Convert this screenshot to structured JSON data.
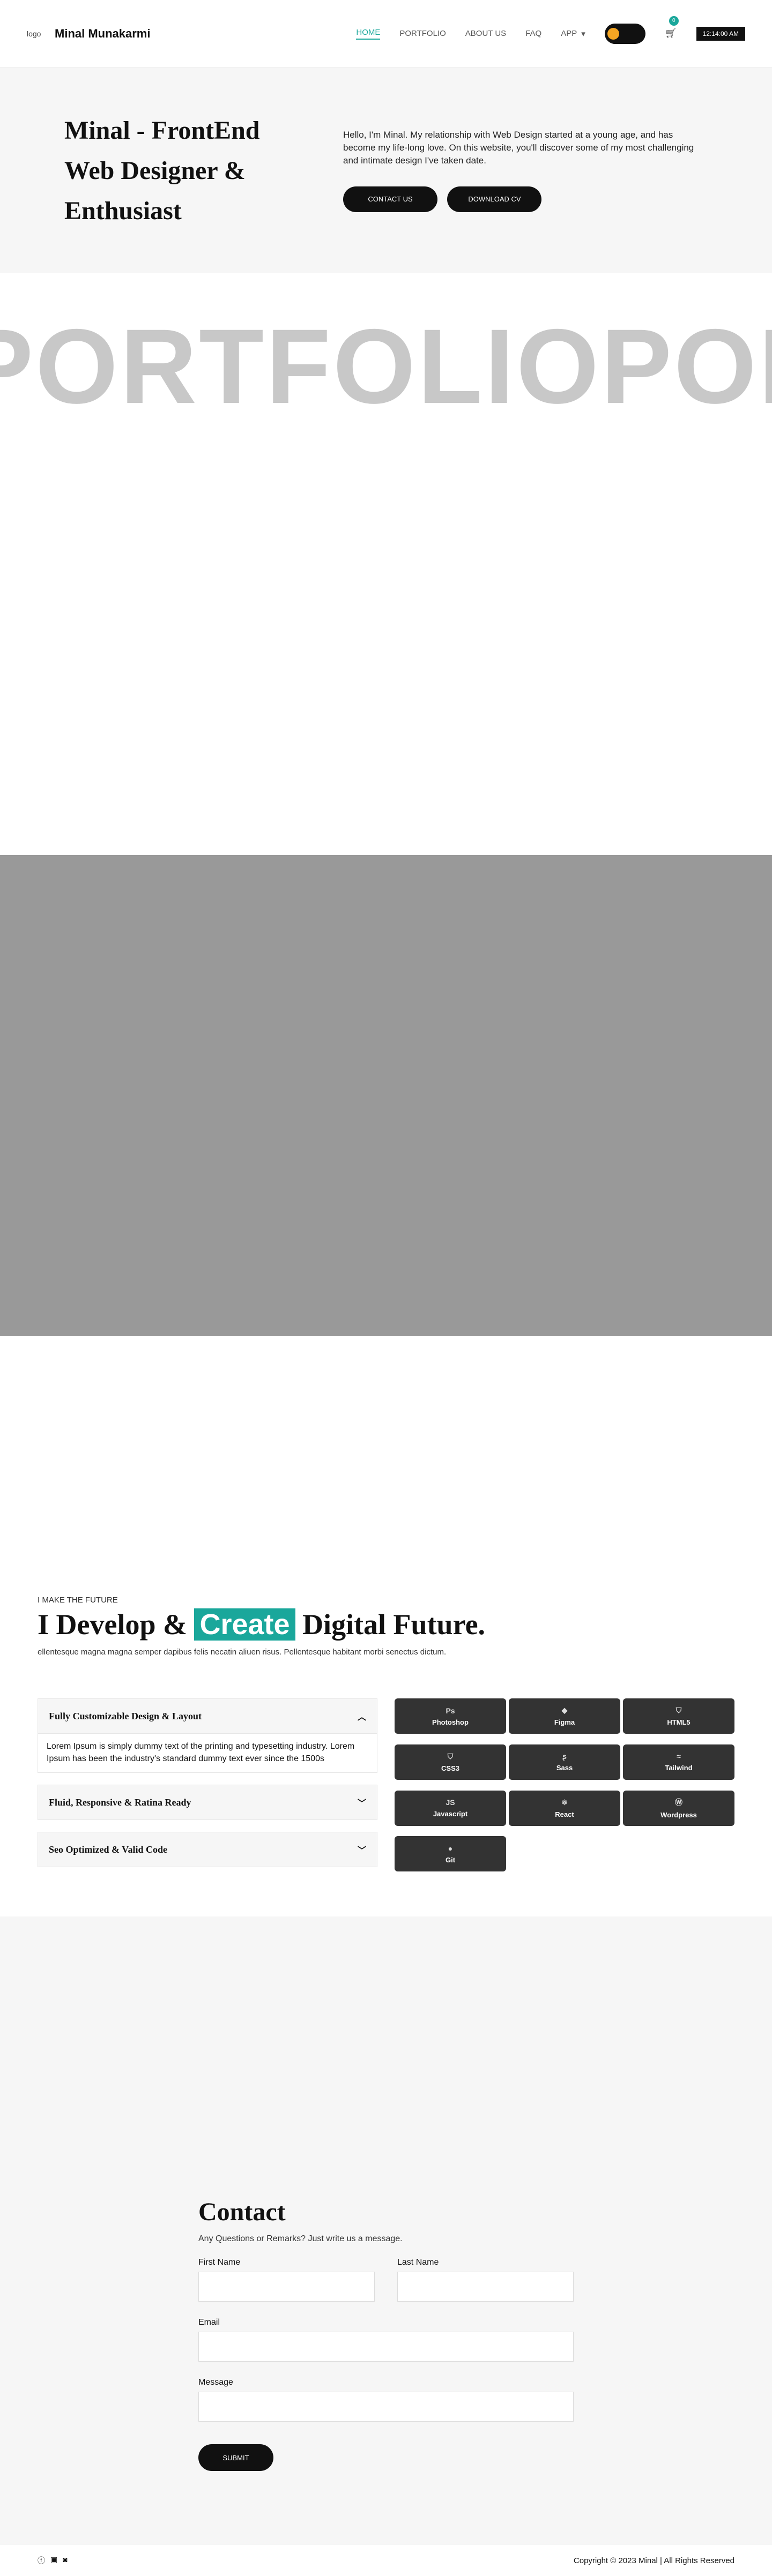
{
  "header": {
    "logo_alt": "logo",
    "brand": "Minal Munakarmi",
    "nav": [
      "HOME",
      "PORTFOLIO",
      "ABOUT US",
      "FAQ"
    ],
    "app_label": "APP",
    "cart_count": "0",
    "clock": "12:14:00 AM"
  },
  "hero": {
    "title": "Minal - FrontEnd Web Designer & Enthusiast",
    "intro": "Hello, I'm Minal. My relationship with Web Design started at a young age, and has become my life-long love. On this website, you'll discover some of my most challenging and intimate design I've taken date.",
    "contact_btn": "CONTACT US",
    "cv_btn": "DOWNLOAD CV"
  },
  "marquee": {
    "text": "PORTFOLIOPORTFOLIO"
  },
  "skills": {
    "kicker": "I MAKE THE FUTURE",
    "title_before": "I Develop &",
    "title_highlight": "Create",
    "title_after": "Digital Future.",
    "subtitle": "ellentesque magna magna semper dapibus felis necatin aliuen risus. Pellentesque habitant morbi senectus dictum.",
    "accordion": [
      {
        "title": "Fully Customizable Design & Layout",
        "open": true,
        "body": "Lorem Ipsum is simply dummy text of the printing and typesetting industry. Lorem Ipsum has been the industry's standard dummy text ever since the 1500s"
      },
      {
        "title": "Fluid, Responsive & Ratina Ready",
        "open": false
      },
      {
        "title": "Seo Optimized & Valid Code",
        "open": false
      }
    ],
    "tools": [
      "Photoshop",
      "Figma",
      "HTML5",
      "CSS3",
      "Sass",
      "Tailwind",
      "Javascript",
      "React",
      "Wordpress",
      "Git"
    ]
  },
  "contact": {
    "title": "Contact",
    "lead": "Any Questions or Remarks? Just write us a message.",
    "first_name": "First Name",
    "last_name": "Last Name",
    "email": "Email",
    "message": "Message",
    "submit": "SUBMIT"
  },
  "footer": {
    "copyright": "Copyright © 2023 Minal | All Rights Reserved"
  },
  "colors": {
    "accent": "#1aa79b",
    "dark": "#111111",
    "toggle_knob": "#f5a623"
  }
}
